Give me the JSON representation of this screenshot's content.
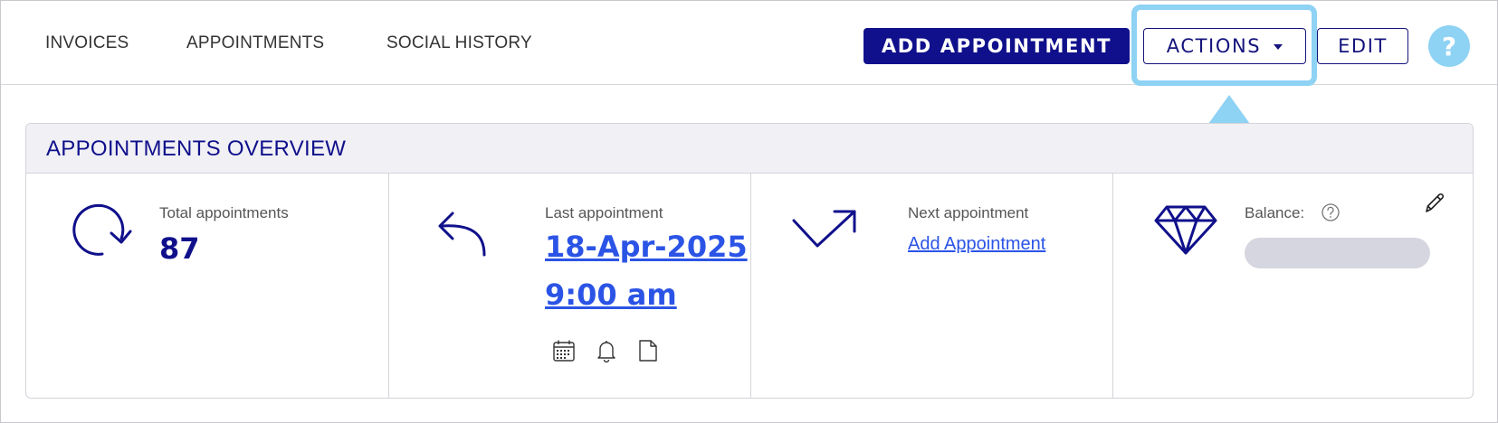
{
  "nav": {
    "tabs": [
      "INVOICES",
      "APPOINTMENTS",
      "SOCIAL HISTORY"
    ]
  },
  "toolbar": {
    "add_appointment_label": "ADD APPOINTMENT",
    "actions_label": "ACTIONS",
    "edit_label": "EDIT",
    "help_label": "?"
  },
  "overview": {
    "title": "APPOINTMENTS OVERVIEW",
    "total": {
      "label": "Total appointments",
      "value": "87",
      "icon": "refresh-icon"
    },
    "last": {
      "label": "Last appointment",
      "date": "18-Apr-2025",
      "time": "9:00 am",
      "icon": "undo-arrow-icon",
      "actions": [
        "calendar-icon",
        "bell-icon",
        "document-icon"
      ]
    },
    "next": {
      "label": "Next appointment",
      "link": "Add Appointment",
      "icon": "trend-arrow-icon"
    },
    "balance": {
      "label": "Balance:",
      "icon": "diamond-icon"
    }
  },
  "colors": {
    "brand": "#10108c",
    "link": "#2b54e6",
    "highlight": "#8ed2f4",
    "header_bg": "#f0f0f5"
  }
}
